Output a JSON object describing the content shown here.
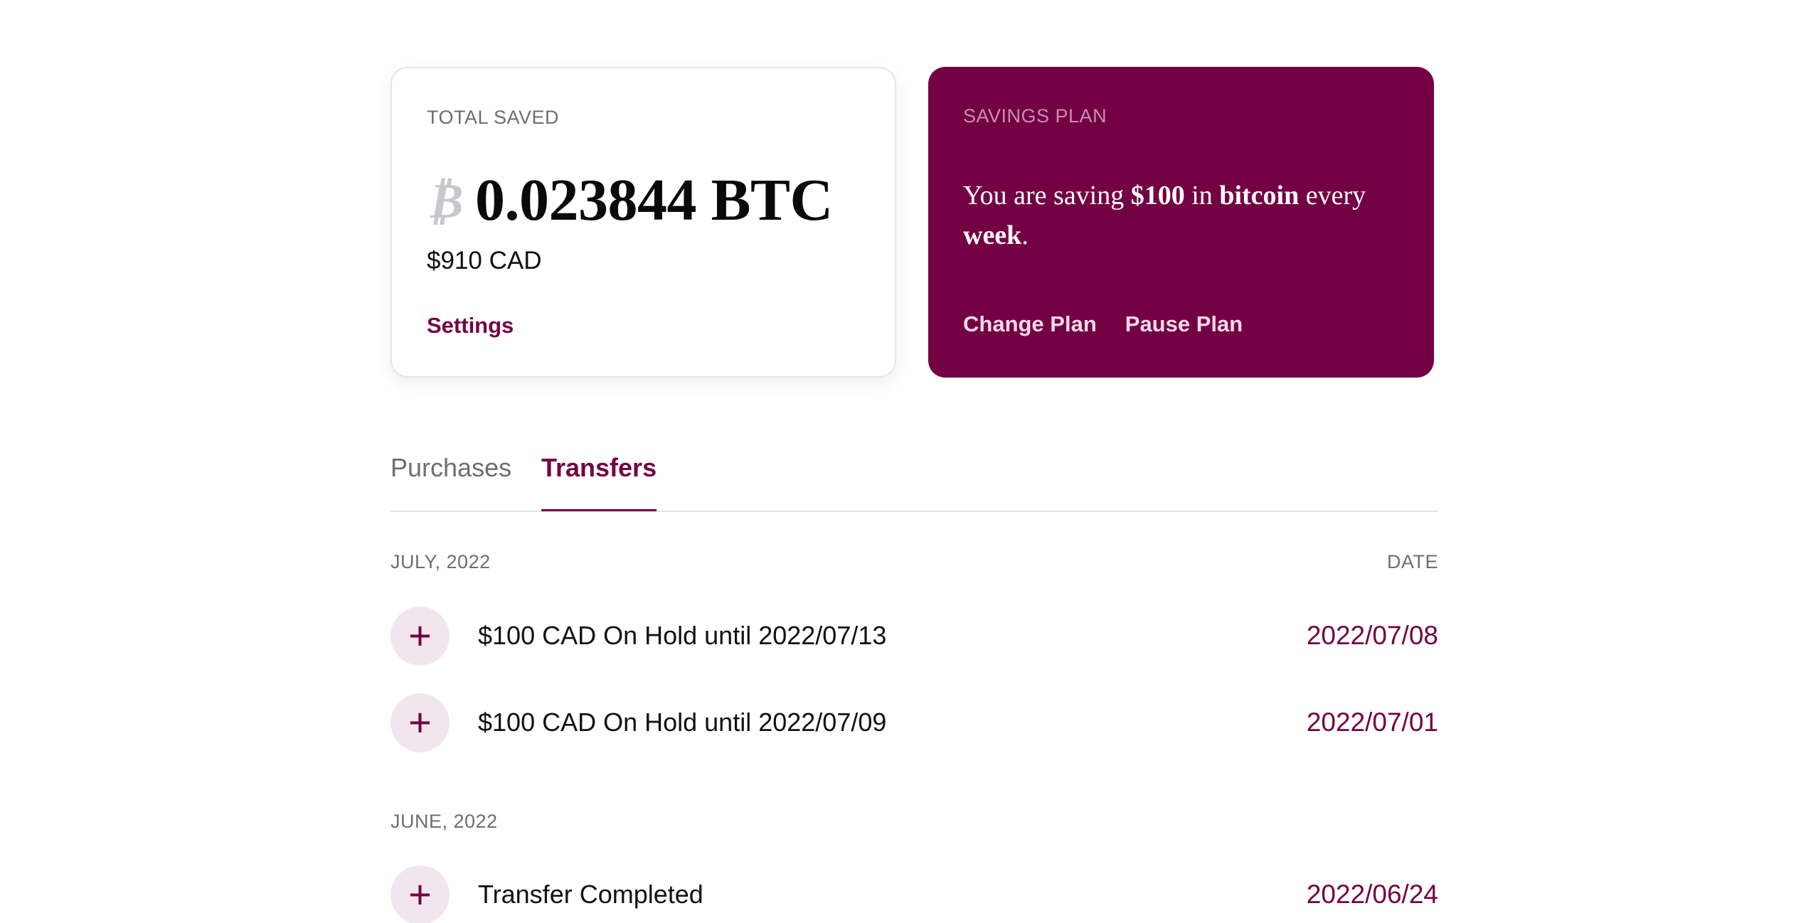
{
  "total_card": {
    "label": "TOTAL SAVED",
    "btc_icon": "bitcoin-icon",
    "btc_symbol": "₿",
    "amount": "0.023844 BTC",
    "fiat": "$910 CAD",
    "settings_label": "Settings"
  },
  "plan_card": {
    "label": "SAVINGS PLAN",
    "text_prefix": "You are saving ",
    "amount": "$100",
    "text_mid1": " in ",
    "asset": "bitcoin",
    "text_mid2": " every ",
    "frequency": "week",
    "text_suffix": ".",
    "change_label": "Change Plan",
    "pause_label": "Pause Plan"
  },
  "tabs": [
    {
      "label": "Purchases",
      "active": false
    },
    {
      "label": "Transfers",
      "active": true
    }
  ],
  "groups": [
    {
      "month": "JULY, 2022",
      "date_header": "DATE",
      "rows": [
        {
          "icon": "plus-icon",
          "symbol": "+",
          "desc": "$100 CAD On Hold until 2022/07/13",
          "date": "2022/07/08"
        },
        {
          "icon": "plus-icon",
          "symbol": "+",
          "desc": "$100 CAD On Hold until 2022/07/09",
          "date": "2022/07/01"
        }
      ]
    },
    {
      "month": "JUNE, 2022",
      "rows": [
        {
          "icon": "plus-icon",
          "symbol": "+",
          "desc": "Transfer Completed",
          "date": "2022/06/24"
        }
      ]
    }
  ],
  "colors": {
    "brand": "#740044",
    "brand_light": "#f2e6ee",
    "muted": "#6e6e72"
  }
}
